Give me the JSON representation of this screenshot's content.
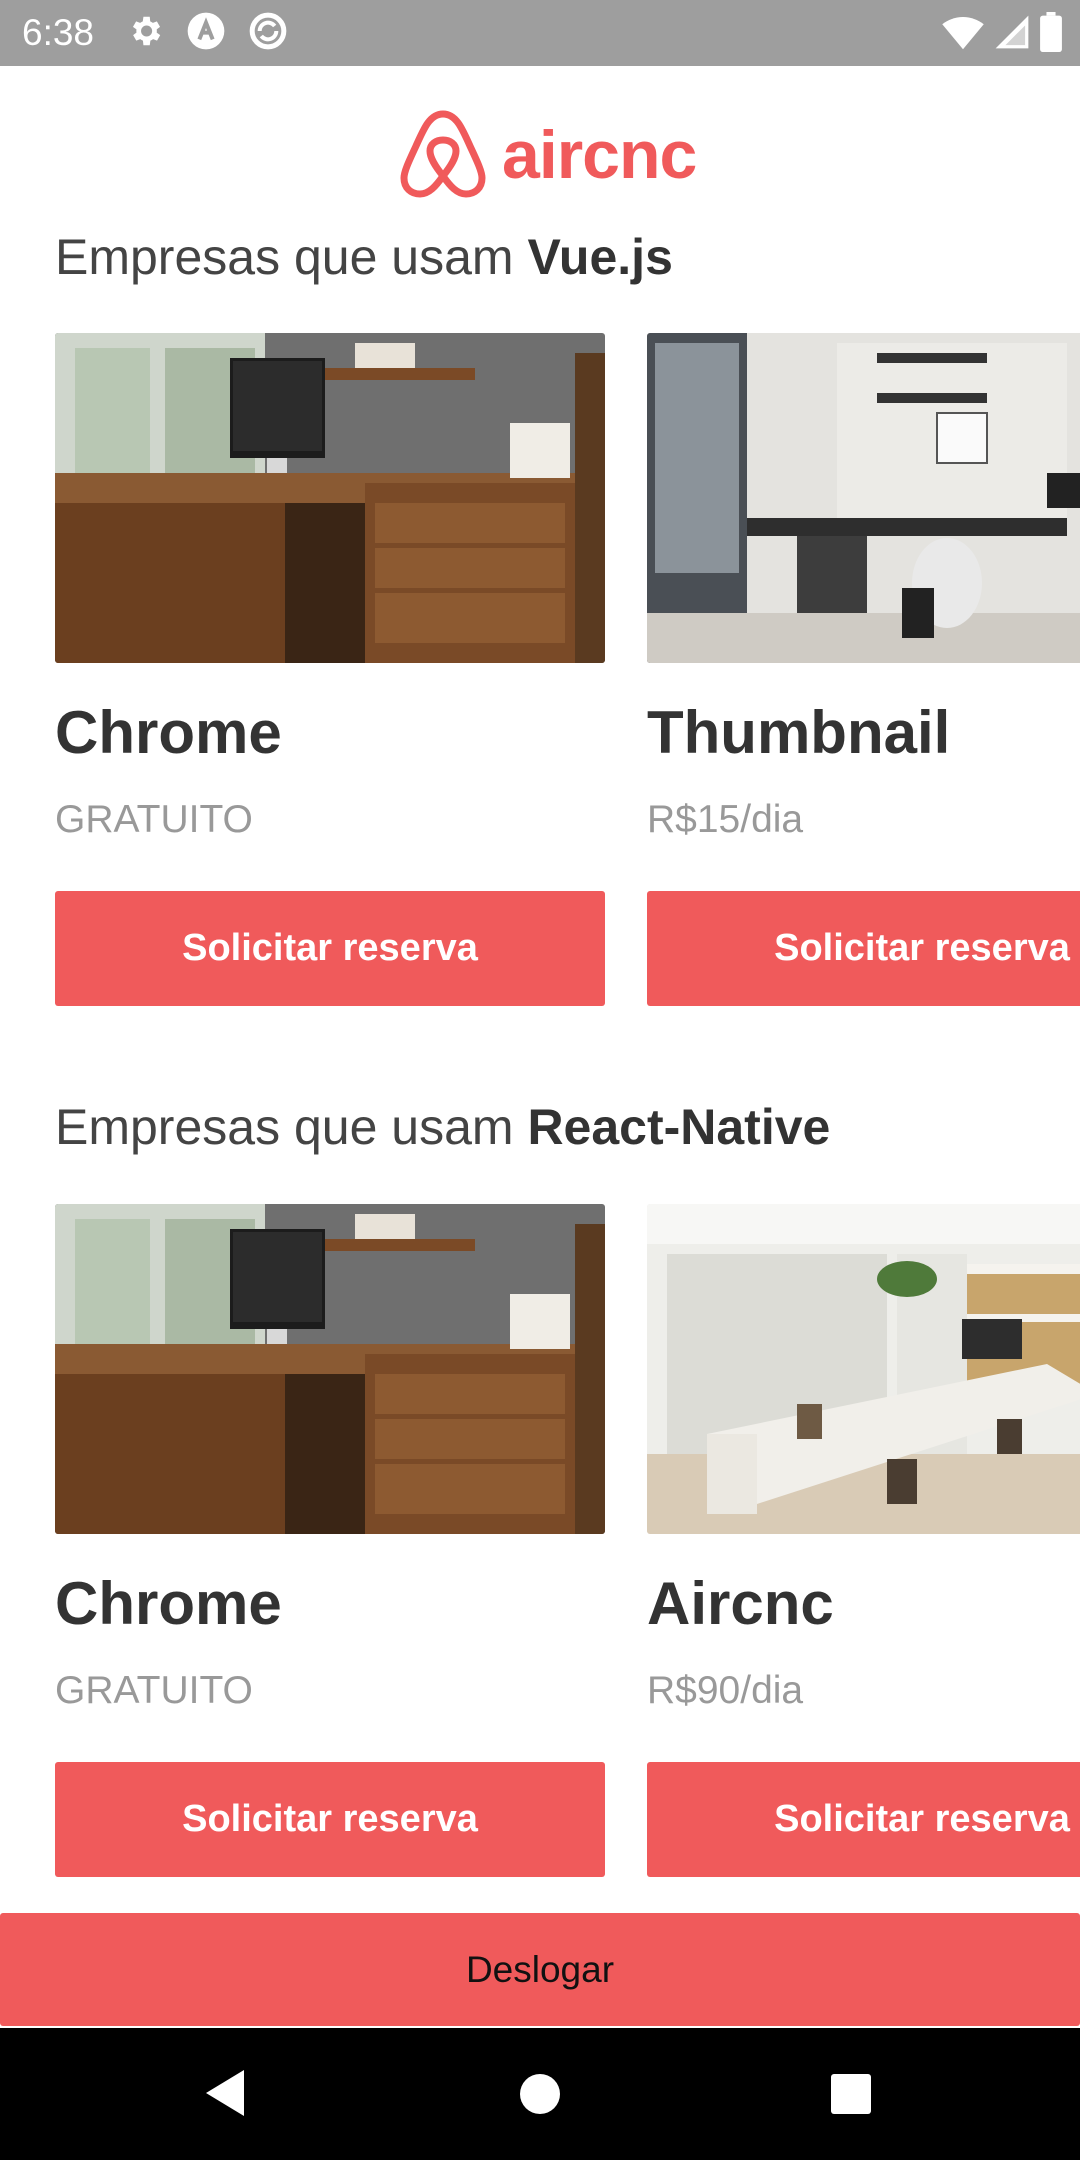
{
  "status_bar": {
    "time": "6:38"
  },
  "brand": {
    "name": "aircnc",
    "color": "#f05a5b"
  },
  "sections": [
    {
      "prefix": "Empresas que usam ",
      "tech": "Vue.js",
      "cards": [
        {
          "name": "Chrome",
          "price": "GRATUITO",
          "button": "Solicitar reserva"
        },
        {
          "name": "Thumbnail",
          "price": "R$15/dia",
          "button": "Solicitar reserva"
        }
      ]
    },
    {
      "prefix": "Empresas que usam ",
      "tech": "React-Native",
      "cards": [
        {
          "name": "Chrome",
          "price": "GRATUITO",
          "button": "Solicitar reserva"
        },
        {
          "name": "Aircnc",
          "price": "R$90/dia",
          "button": "Solicitar reserva"
        }
      ]
    }
  ],
  "logout": {
    "label": "Deslogar"
  },
  "icons": {
    "status_left": [
      "settings-icon",
      "a-icon",
      "sync-icon"
    ],
    "status_right": [
      "wifi-icon",
      "signal-icon",
      "battery-icon"
    ],
    "nav": [
      "back-icon",
      "home-icon",
      "recents-icon"
    ]
  }
}
